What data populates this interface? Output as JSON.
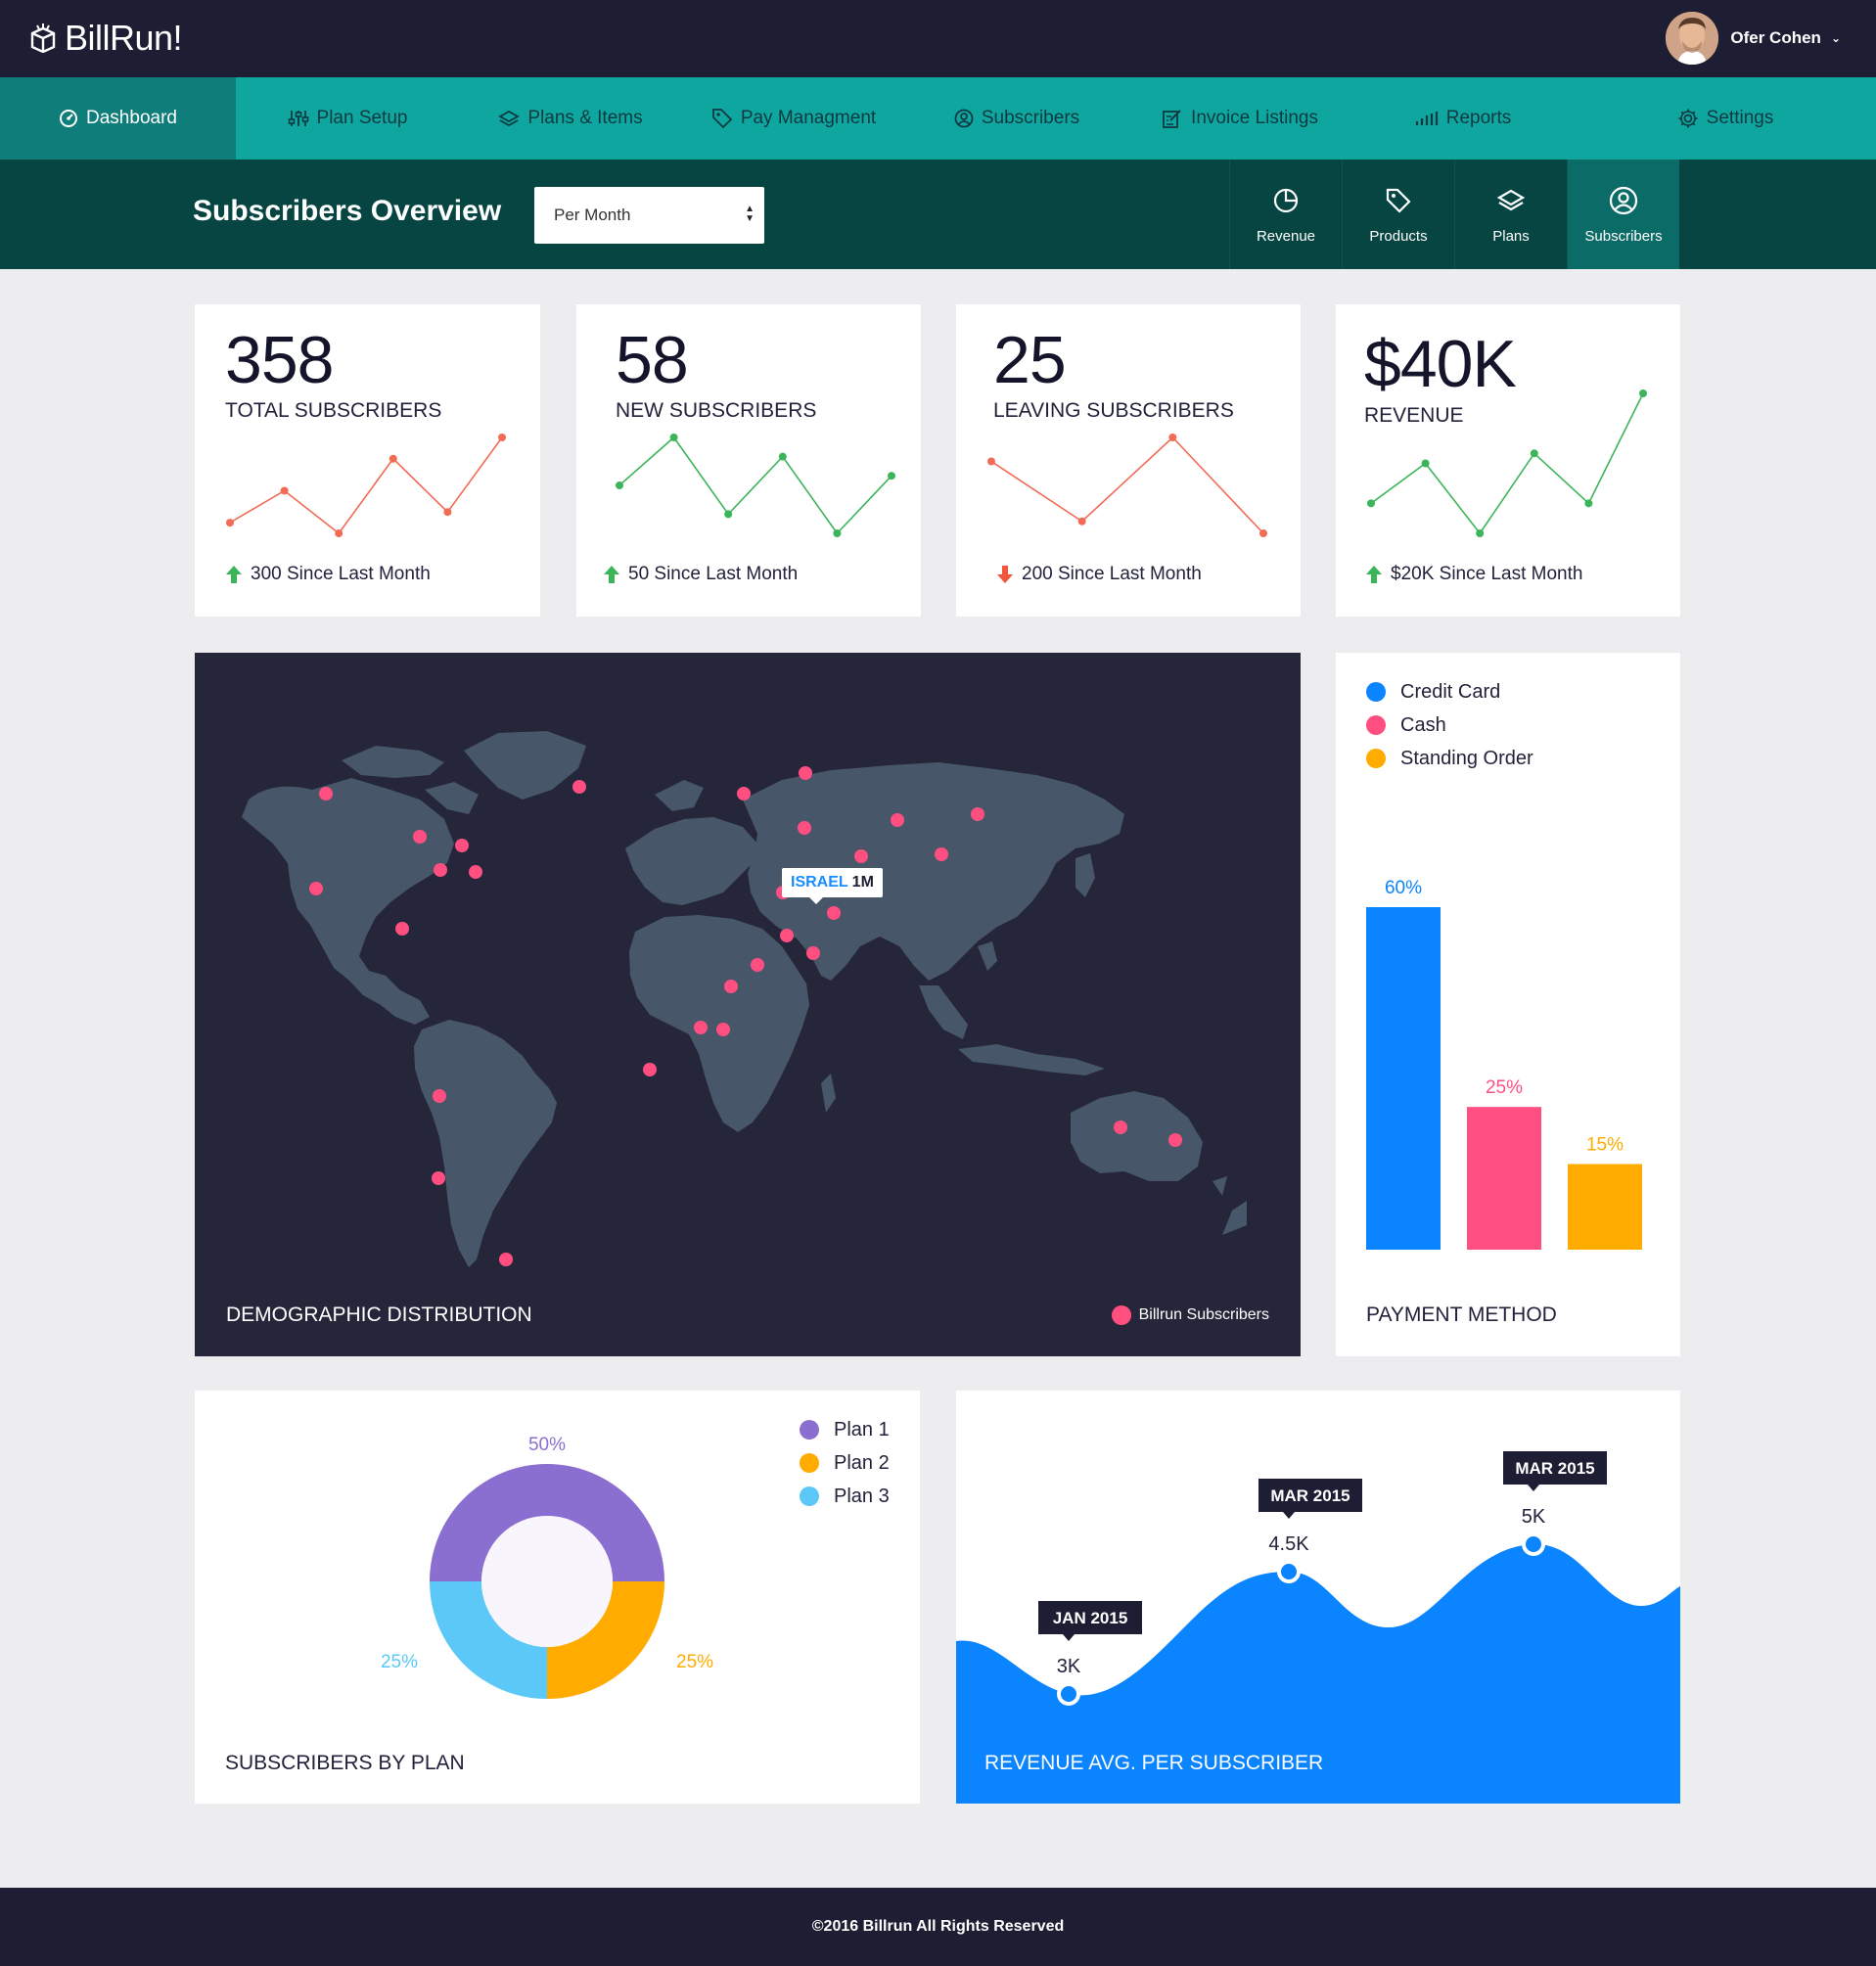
{
  "app": {
    "logo_text": "BillRun!"
  },
  "user": {
    "name": "Ofer Cohen"
  },
  "nav": {
    "items": [
      {
        "label": "Dashboard",
        "icon": "gauge-icon",
        "active": true
      },
      {
        "label": "Plan Setup",
        "icon": "sliders-icon"
      },
      {
        "label": "Plans & Items",
        "icon": "layers-icon"
      },
      {
        "label": "Pay Managment",
        "icon": "tag-icon"
      },
      {
        "label": "Subscribers",
        "icon": "user-circle-icon"
      },
      {
        "label": "Invoice Listings",
        "icon": "edit-document-icon"
      },
      {
        "label": "Reports",
        "icon": "bars-icon"
      },
      {
        "label": "Settings",
        "icon": "gear-icon"
      }
    ]
  },
  "subheader": {
    "title": "Subscribers Overview",
    "period_select": "Per Month",
    "tabs": [
      {
        "label": "Revenue",
        "icon": "pie-icon"
      },
      {
        "label": "Products",
        "icon": "tag-icon"
      },
      {
        "label": "Plans",
        "icon": "layers-icon"
      },
      {
        "label": "Subscribers",
        "icon": "user-circle-icon",
        "active": true
      }
    ]
  },
  "stats": [
    {
      "value": "358",
      "label": "TOTAL SUBSCRIBERS",
      "change": "300 Since Last Month",
      "trend": "up",
      "color": "#f26b55",
      "spark": [
        3,
        6,
        2,
        9,
        4,
        11
      ]
    },
    {
      "value": "58",
      "label": "NEW SUBSCRIBERS",
      "change": "50 Since Last Month",
      "trend": "up",
      "color": "#3cb55a",
      "spark": [
        6,
        11,
        3,
        9,
        1,
        7
      ]
    },
    {
      "value": "25",
      "label": "LEAVING SUBSCRIBERS",
      "change": "200 Since Last Month",
      "trend": "down",
      "color": "#f26b55",
      "spark": [
        7,
        2,
        9,
        1
      ]
    },
    {
      "value": "$40K",
      "label": "REVENUE",
      "change": "$20K Since Last Month",
      "trend": "up",
      "color": "#3cb55a",
      "spark": [
        3,
        7,
        0,
        8,
        3,
        14
      ]
    }
  ],
  "map": {
    "title": "DEMOGRAPHIC DISTRIBUTION",
    "legend": "Billrun Subscribers",
    "tooltip_country": "ISRAEL",
    "tooltip_value": "1M",
    "dot_color": "#ff4f81"
  },
  "payment": {
    "title": "PAYMENT METHOD",
    "legend": [
      {
        "label": "Credit Card",
        "color": "#0a84ff"
      },
      {
        "label": "Cash",
        "color": "#ff4f81"
      },
      {
        "label": "Standing Order",
        "color": "#ffab00"
      }
    ],
    "chart_data": {
      "type": "bar",
      "categories": [
        "Credit Card",
        "Cash",
        "Standing Order"
      ],
      "values": [
        60,
        25,
        15
      ],
      "value_labels": [
        "60%",
        "25%",
        "15%"
      ],
      "colors": [
        "#0a84ff",
        "#ff4f81",
        "#ffab00"
      ]
    }
  },
  "plans": {
    "title": "SUBSCRIBERS BY PLAN",
    "legend": [
      {
        "label": "Plan 1",
        "color": "#8b6fd0"
      },
      {
        "label": "Plan 2",
        "color": "#ffab00"
      },
      {
        "label": "Plan 3",
        "color": "#5bc8f7"
      }
    ],
    "chart_data": {
      "type": "pie",
      "categories": [
        "Plan 1",
        "Plan 2",
        "Plan 3"
      ],
      "values": [
        50,
        25,
        25
      ],
      "value_labels": [
        "50%",
        "25%",
        "25%"
      ],
      "colors": [
        "#8b6fd0",
        "#ffab00",
        "#5bc8f7"
      ]
    }
  },
  "revenue_avg": {
    "title": "REVENUE AVG. PER SUBSCRIBER",
    "color": "#0a84ff",
    "chart_data": {
      "type": "area",
      "points": [
        {
          "date": "JAN 2015",
          "value": 3,
          "label": "3K"
        },
        {
          "date": "MAR 2015",
          "value": 4.5,
          "label": "4.5K"
        },
        {
          "date": "MAR 2015",
          "value": 5,
          "label": "5K"
        }
      ]
    }
  },
  "footer": {
    "text": "©2016 Billrun All Rights Reserved"
  }
}
